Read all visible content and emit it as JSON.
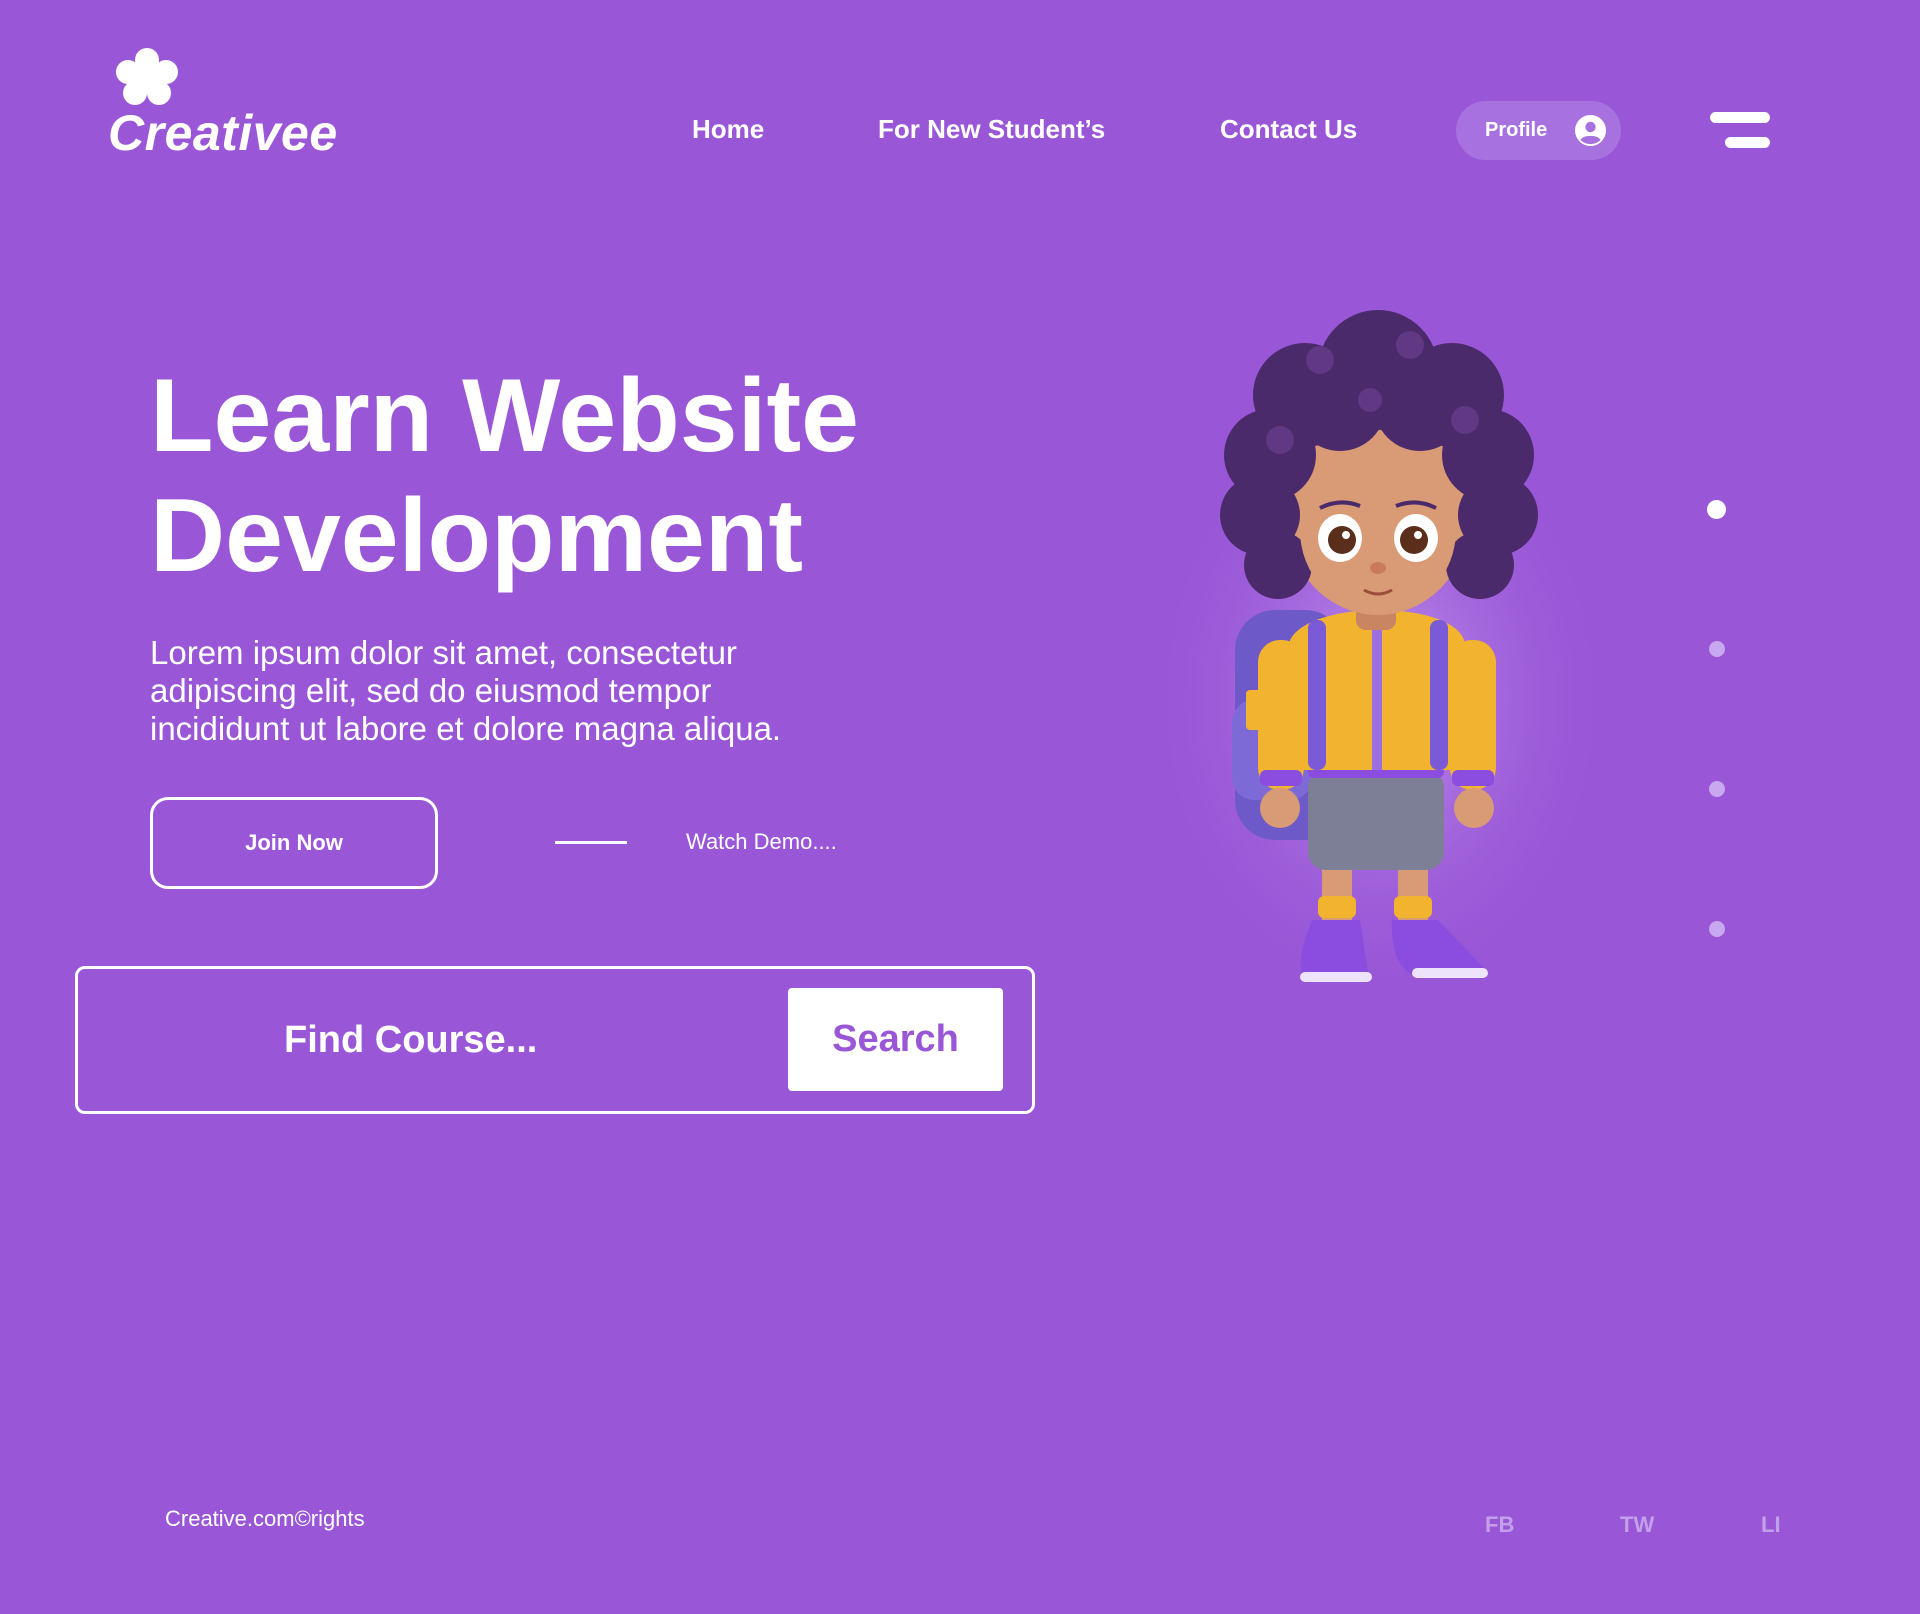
{
  "colors": {
    "background": "#9957D7",
    "text": "#FFFFFF",
    "profile_pill": "#A771E0",
    "search_button_text": "#9957D7",
    "social_text": "#C2A1EA",
    "dot_inactive": "#C8A8EE"
  },
  "header": {
    "logo": {
      "icon": "flower-icon",
      "text": "Creativee"
    },
    "nav": [
      {
        "label": "Home"
      },
      {
        "label": "For New Student’s"
      },
      {
        "label": "Contact Us"
      }
    ],
    "profile": {
      "label": "Profile",
      "icon": "user-circle-icon"
    },
    "menu_icon": "hamburger-menu-icon"
  },
  "hero": {
    "title_line1": "Learn Website",
    "title_line2": "Development",
    "description": "Lorem ipsum dolor sit amet, consectetur adipiscing elit, sed do eiusmod tempor incididunt ut labore et dolore magna aliqua.",
    "join_label": "Join Now",
    "demo_label": "Watch Demo...."
  },
  "search": {
    "placeholder": "Find Course...",
    "button_label": "Search"
  },
  "illustration": {
    "icon": "student-character-illustration"
  },
  "slider": {
    "count": 4,
    "active_index": 0
  },
  "footer": {
    "copyright": "Creative.com©rights",
    "social": [
      {
        "label": "FB"
      },
      {
        "label": "TW"
      },
      {
        "label": "LI"
      }
    ]
  }
}
